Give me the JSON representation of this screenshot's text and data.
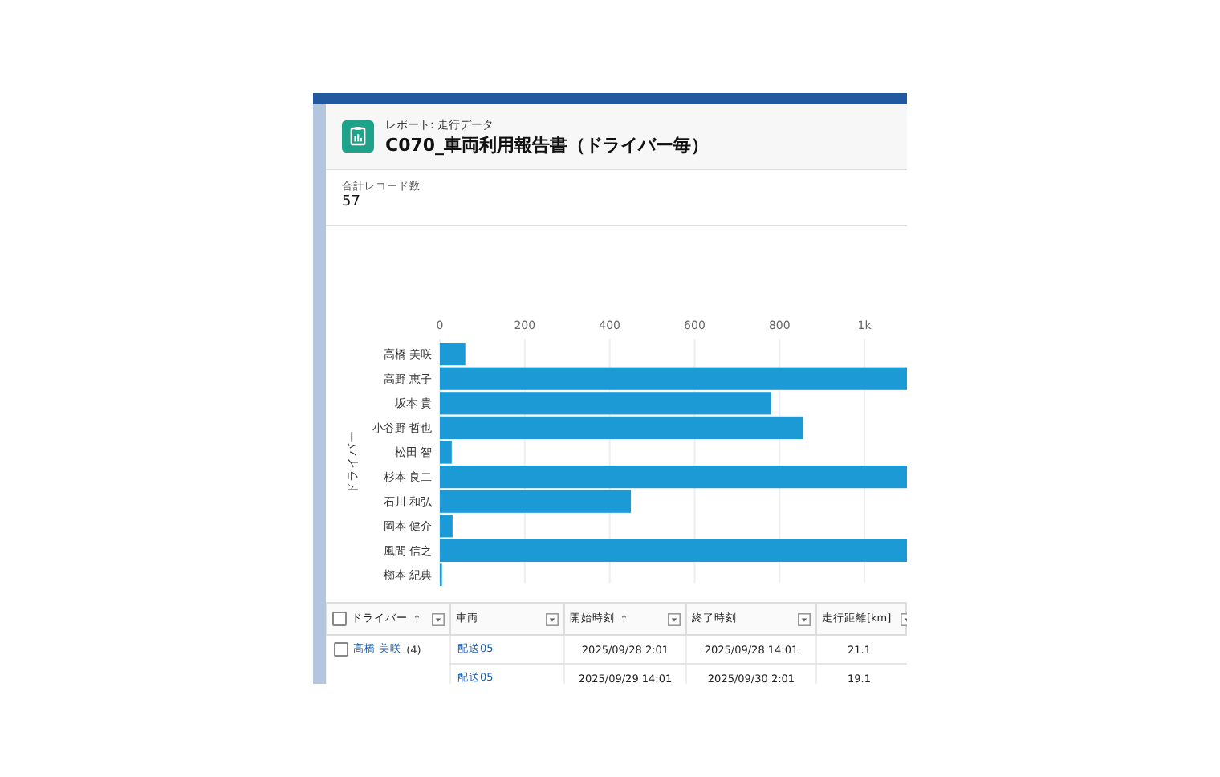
{
  "report": {
    "subtitle": "レポート: 走行データ",
    "title": "C070_車両利用報告書（ドライバー毎）"
  },
  "summary": {
    "label": "合計レコード数",
    "value": "57"
  },
  "chart": {
    "chart_data": {
      "type": "bar",
      "orientation": "horizontal",
      "ylabel": "ドライバー",
      "categories": [
        "高橋 美咲",
        "高野 恵子",
        "坂本 貴",
        "小谷野 哲也",
        "松田 智",
        "杉本 良二",
        "石川 和弘",
        "岡本 健介",
        "風間 信之",
        "櫛本 紀典"
      ],
      "values": [
        60,
        1100,
        780,
        855,
        28,
        1100,
        450,
        30,
        1100,
        5
      ],
      "xlim": [
        0,
        1100
      ],
      "grid": true,
      "xticks": [
        0,
        200,
        400,
        600,
        800,
        {
          "value": 1000,
          "label": "1k"
        }
      ]
    }
  },
  "table": {
    "select_all": {
      "checked": false
    },
    "columns": [
      {
        "label": "ドライバー",
        "sort": "↑"
      },
      {
        "label": "車両"
      },
      {
        "label": "開始時刻",
        "sort": "↑"
      },
      {
        "label": "終了時刻"
      },
      {
        "label": "走行距離[km]"
      }
    ],
    "groups": [
      {
        "driver": "高橋 美咲",
        "count": "(4)",
        "checked": false,
        "rows": [
          {
            "vehicle": "配送05",
            "start": "2025/09/28 2:01",
            "end": "2025/09/28 14:01",
            "distance": "21.1"
          },
          {
            "vehicle": "配送05",
            "start": "2025/09/29 14:01",
            "end": "2025/09/30 2:01",
            "distance": "19.1"
          }
        ]
      }
    ]
  }
}
